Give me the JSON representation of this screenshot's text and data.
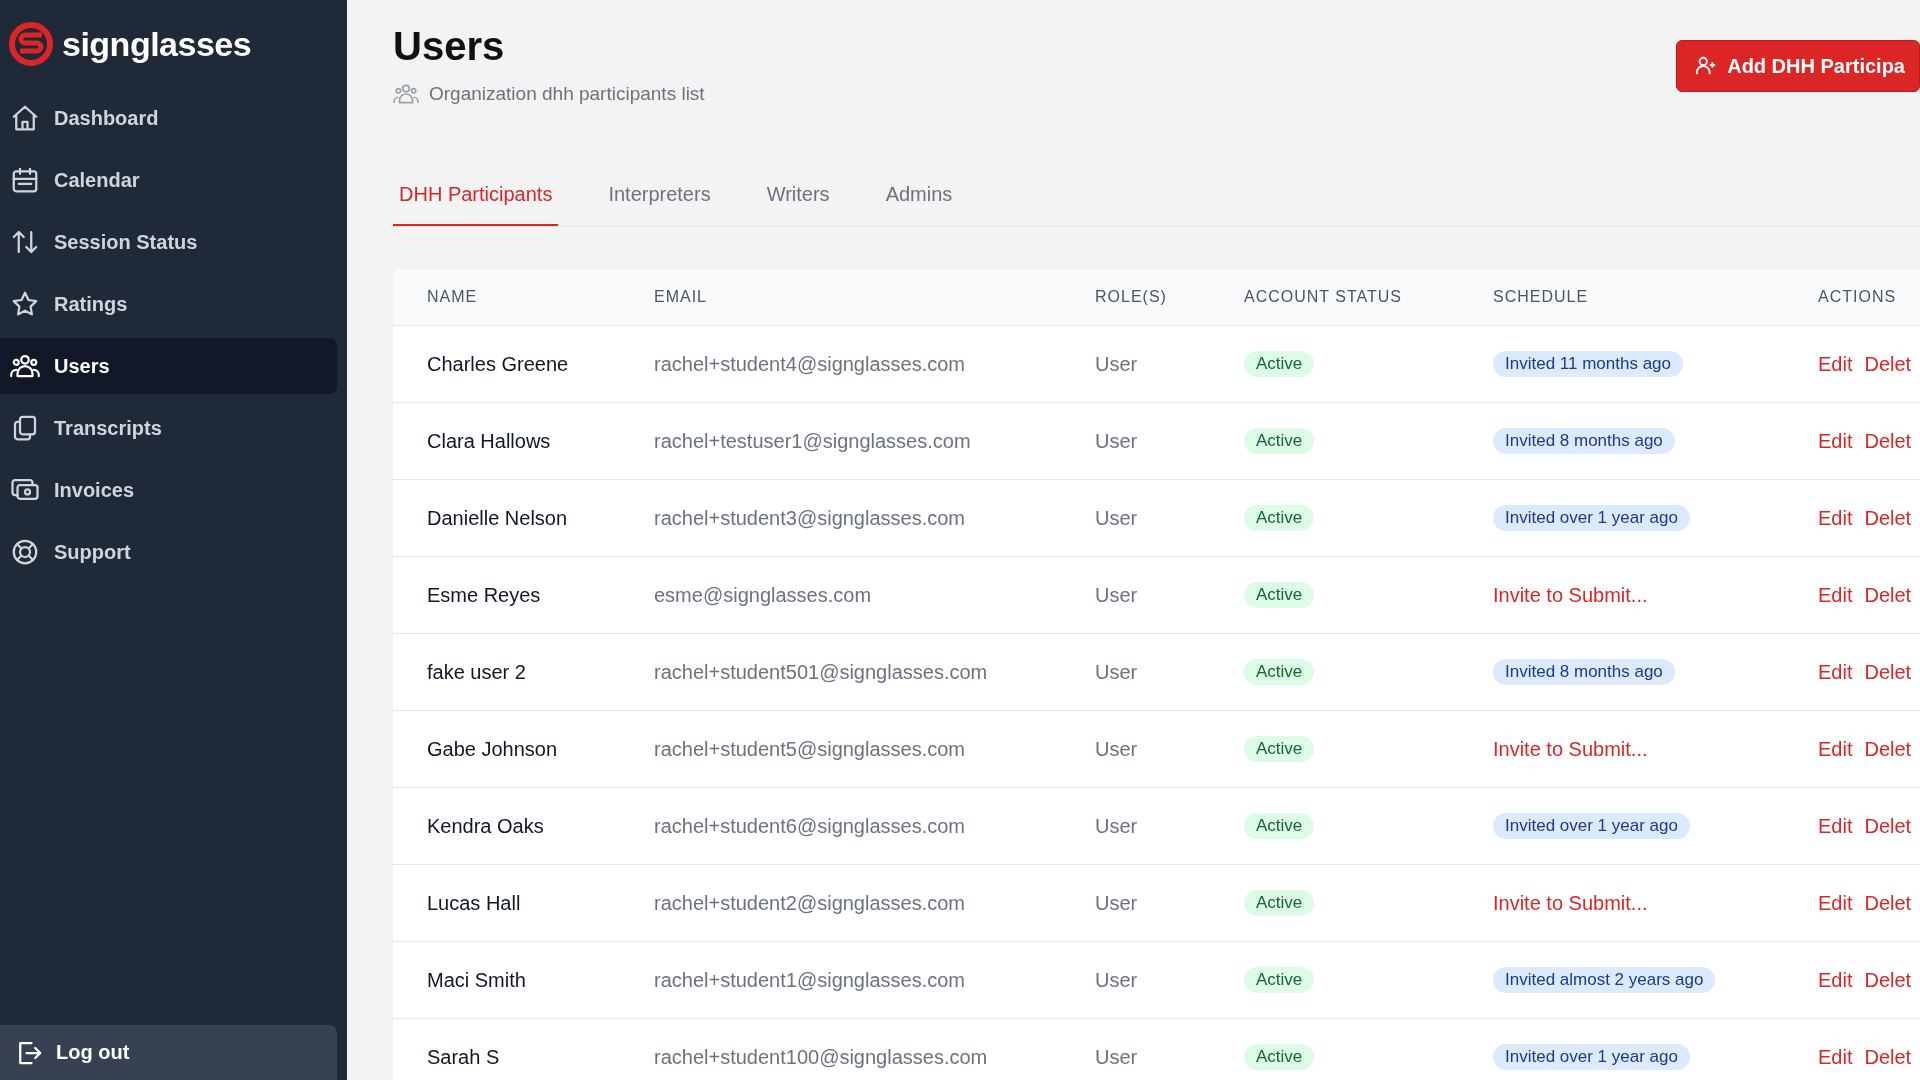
{
  "sidebar": {
    "brand": "signglasses",
    "items": [
      {
        "label": "Dashboard",
        "selected": false
      },
      {
        "label": "Calendar",
        "selected": false
      },
      {
        "label": "Session Status",
        "selected": false
      },
      {
        "label": "Ratings",
        "selected": false
      },
      {
        "label": "Users",
        "selected": true
      },
      {
        "label": "Transcripts",
        "selected": false
      },
      {
        "label": "Invoices",
        "selected": false
      },
      {
        "label": "Support",
        "selected": false
      }
    ],
    "logout": "Log out"
  },
  "header": {
    "title": "Users",
    "subtitle": "Organization dhh participants list",
    "add_button": "Add DHH Participa"
  },
  "tabs": [
    {
      "label": "DHH Participants",
      "selected": true
    },
    {
      "label": "Interpreters",
      "selected": false
    },
    {
      "label": "Writers",
      "selected": false
    },
    {
      "label": "Admins",
      "selected": false
    }
  ],
  "table": {
    "columns": [
      "NAME",
      "EMAIL",
      "ROLE(S)",
      "ACCOUNT STATUS",
      "SCHEDULE",
      "ACTIONS"
    ],
    "rows": [
      {
        "name": "Charles Greene",
        "email": "rachel+student4@signglasses.com",
        "role": "User",
        "status": "Active",
        "schedule": {
          "kind": "badge",
          "text": "Invited 11 months ago"
        },
        "actions": [
          "Edit",
          "Delet"
        ]
      },
      {
        "name": "Clara Hallows",
        "email": "rachel+testuser1@signglasses.com",
        "role": "User",
        "status": "Active",
        "schedule": {
          "kind": "badge",
          "text": "Invited 8 months ago"
        },
        "actions": [
          "Edit",
          "Delet"
        ]
      },
      {
        "name": "Danielle Nelson",
        "email": "rachel+student3@signglasses.com",
        "role": "User",
        "status": "Active",
        "schedule": {
          "kind": "badge",
          "text": "Invited over 1 year ago"
        },
        "actions": [
          "Edit",
          "Delet"
        ]
      },
      {
        "name": "Esme Reyes",
        "email": "esme@signglasses.com",
        "role": "User",
        "status": "Active",
        "schedule": {
          "kind": "link",
          "text": "Invite to Submit..."
        },
        "actions": [
          "Edit",
          "Delet"
        ]
      },
      {
        "name": "fake user 2",
        "email": "rachel+student501@signglasses.com",
        "role": "User",
        "status": "Active",
        "schedule": {
          "kind": "badge",
          "text": "Invited 8 months ago"
        },
        "actions": [
          "Edit",
          "Delet"
        ]
      },
      {
        "name": "Gabe Johnson",
        "email": "rachel+student5@signglasses.com",
        "role": "User",
        "status": "Active",
        "schedule": {
          "kind": "link",
          "text": "Invite to Submit..."
        },
        "actions": [
          "Edit",
          "Delet"
        ]
      },
      {
        "name": "Kendra Oaks",
        "email": "rachel+student6@signglasses.com",
        "role": "User",
        "status": "Active",
        "schedule": {
          "kind": "badge",
          "text": "Invited over 1 year ago"
        },
        "actions": [
          "Edit",
          "Delet"
        ]
      },
      {
        "name": "Lucas Hall",
        "email": "rachel+student2@signglasses.com",
        "role": "User",
        "status": "Active",
        "schedule": {
          "kind": "link",
          "text": "Invite to Submit..."
        },
        "actions": [
          "Edit",
          "Delet"
        ]
      },
      {
        "name": "Maci Smith",
        "email": "rachel+student1@signglasses.com",
        "role": "User",
        "status": "Active",
        "schedule": {
          "kind": "badge",
          "text": "Invited almost 2 years ago"
        },
        "actions": [
          "Edit",
          "Delet"
        ]
      },
      {
        "name": "Sarah S",
        "email": "rachel+student100@signglasses.com",
        "role": "User",
        "status": "Active",
        "schedule": {
          "kind": "badge",
          "text": "Invited over 1 year ago"
        },
        "actions": [
          "Edit",
          "Delet"
        ]
      }
    ]
  }
}
